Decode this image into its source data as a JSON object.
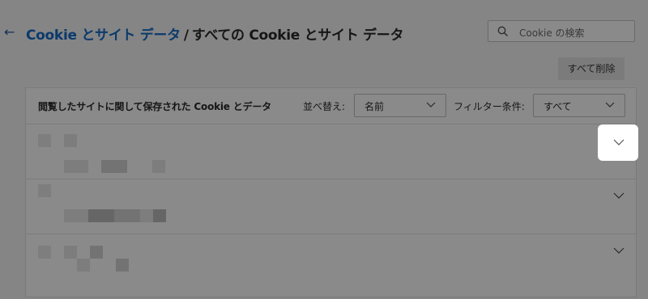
{
  "header": {
    "back_icon": "arrow-left-icon",
    "breadcrumb_link": "Cookie とサイト データ",
    "breadcrumb_separator": "/",
    "page_title": "すべての Cookie とサイト データ"
  },
  "search": {
    "placeholder": "Cookie の検索",
    "icon": "search-icon"
  },
  "actions": {
    "delete_all": "すべて削除"
  },
  "panel": {
    "title": "閲覧したサイトに関して保存された Cookie とデータ",
    "sort_label": "並べ替え:",
    "sort_value": "名前",
    "filter_label": "フィルター条件:",
    "filter_value": "すべて"
  },
  "colors": {
    "overlay_bg": "#858585",
    "link": "#0b3a6b",
    "highlight": "#ffffff"
  }
}
